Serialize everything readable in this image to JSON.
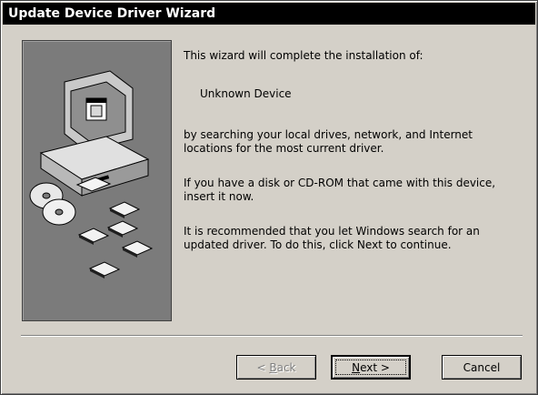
{
  "window": {
    "title": "Update Device Driver Wizard"
  },
  "content": {
    "intro": "This wizard will complete the installation of:",
    "device_name": "Unknown Device",
    "para1_line1": "by searching your local drives, network, and Internet",
    "para1_line2": "locations for the most current driver.",
    "para2_line1": "If you have a disk or CD-ROM that came with this device,",
    "para2_line2": "insert it now.",
    "para3_line1": "It is recommended that you let Windows search for an",
    "para3_line2": "updated driver. To do this, click Next to continue."
  },
  "buttons": {
    "back_prefix": "< ",
    "back_hotkey": "B",
    "back_rest": "ack",
    "next_hotkey": "N",
    "next_rest": "ext >",
    "cancel_label": "Cancel"
  },
  "colors": {
    "dialog_bg": "#d4d0c8",
    "title_bg": "#000000",
    "art_bg": "#7b7b7b"
  },
  "icons": [
    "computer-icon",
    "cd-discs-icon",
    "floppy-disk-icon"
  ]
}
